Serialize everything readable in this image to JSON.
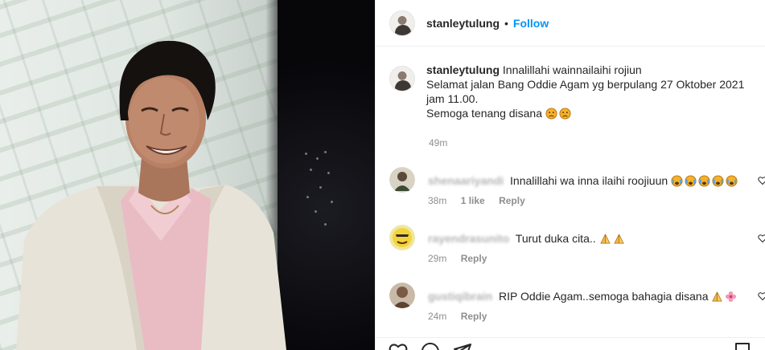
{
  "post": {
    "username": "stanleytulung",
    "separator": "•",
    "follow_label": "Follow"
  },
  "caption": {
    "username": "stanleytulung",
    "line1": "Innalillahi wainnailaihi rojiun",
    "line2": "Selamat jalan Bang Oddie Agam yg berpulang 27 Oktober 2021",
    "line3": "jam 11.00.",
    "line4": "Semoga tenang disana",
    "time": "49m"
  },
  "comments": [
    {
      "username": "shenaariyandi",
      "text": "Innalillahi wa inna ilaihi roojiuun",
      "time": "38m",
      "likes": "1 like",
      "reply_label": "Reply",
      "emoji": "crying-face x5"
    },
    {
      "username": "rayendrasunito",
      "text": "Turut duka cita..",
      "time": "29m",
      "reply_label": "Reply",
      "emoji": "folded-hands x2"
    },
    {
      "username": "gustiqibrain",
      "text": "RIP Oddie Agam..semoga bahagia disana",
      "time": "24m",
      "reply_label": "Reply",
      "emoji": "folded-hands, flower"
    }
  ],
  "colors": {
    "link": "#0095f6",
    "text": "#262626",
    "muted": "#8e8e8e",
    "border": "#efefef"
  },
  "icons": [
    "heart-icon",
    "comment-icon",
    "share-icon",
    "bookmark-icon"
  ]
}
